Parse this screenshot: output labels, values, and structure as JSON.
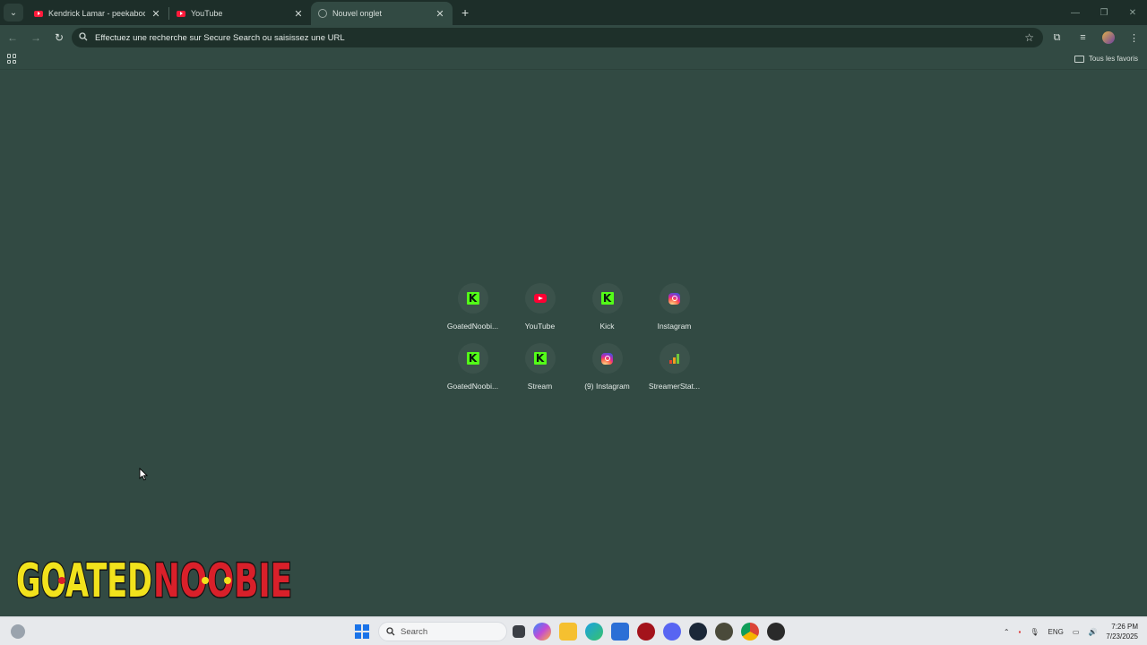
{
  "browser": {
    "tabs": [
      {
        "title": "Kendrick Lamar - peekaboo (Of",
        "favicon": "youtube-icon",
        "active": false
      },
      {
        "title": "YouTube",
        "favicon": "youtube-icon",
        "active": false
      },
      {
        "title": "Nouvel onglet",
        "favicon": "globe-icon",
        "active": true
      }
    ],
    "new_tab_symbol": "+",
    "close_symbol": "✕",
    "address_bar": {
      "placeholder": "Effectuez une recherche sur Secure Search ou saisissez une URL"
    },
    "bookmarks_bar": {
      "all_bookmarks_label": "Tous les favoris"
    }
  },
  "new_tab_page": {
    "shortcuts": [
      {
        "label": "GoatedNoobi...",
        "icon": "kick-icon"
      },
      {
        "label": "YouTube",
        "icon": "youtube-icon"
      },
      {
        "label": "Kick",
        "icon": "kick-icon"
      },
      {
        "label": "Instagram",
        "icon": "instagram-icon"
      },
      {
        "label": "GoatedNoobi...",
        "icon": "kick-icon"
      },
      {
        "label": "Stream",
        "icon": "kick-icon"
      },
      {
        "label": "(9) Instagram",
        "icon": "instagram-icon"
      },
      {
        "label": "StreamerStat...",
        "icon": "bar-chart-icon"
      }
    ]
  },
  "overlay": {
    "logo_text": "GOATEDNOOBIE",
    "logo_part_1": "GOATED",
    "logo_part_2": "NOOBIE"
  },
  "taskbar": {
    "search_placeholder": "Search",
    "language": "ENG",
    "time": "7:26 PM",
    "date": "7/23/2025"
  },
  "colors": {
    "page_background": "#324a43",
    "tab_strip": "#1d2e29",
    "omnibox": "#1e302a",
    "kick_green": "#53fc18",
    "youtube_red": "#ff0033",
    "logo_yellow": "#f2e21c",
    "logo_red": "#d9202a"
  }
}
